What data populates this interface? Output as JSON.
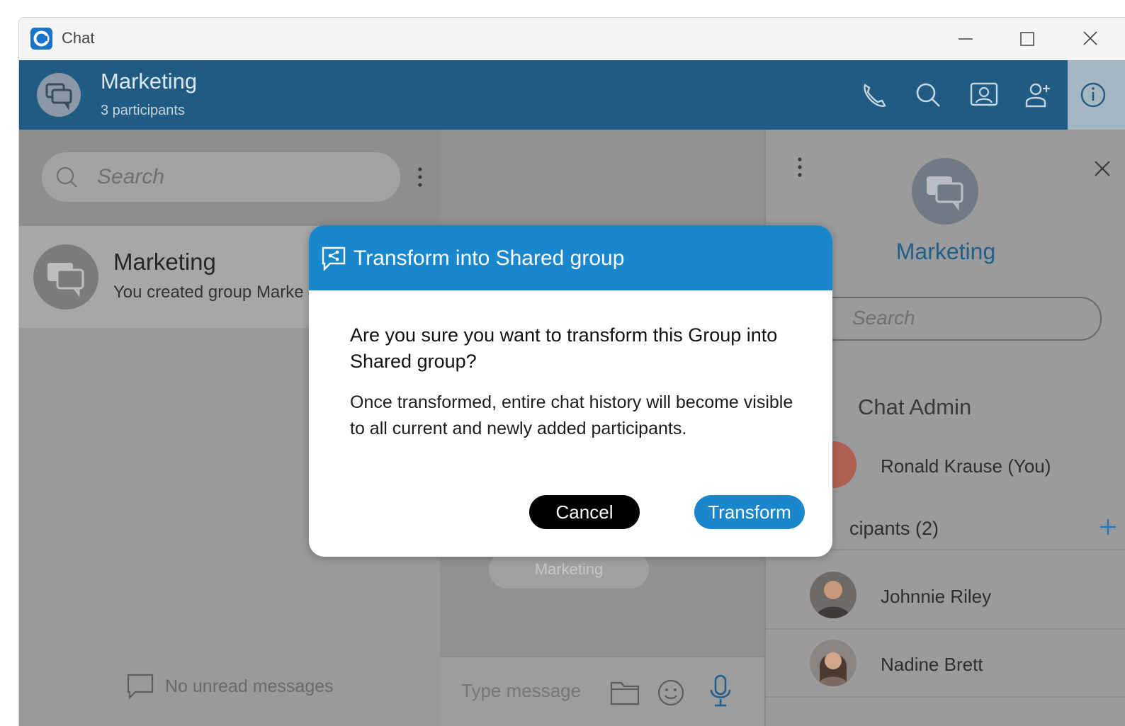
{
  "window": {
    "title": "Chat"
  },
  "header": {
    "title": "Marketing",
    "subtitle": "3 participants"
  },
  "left_pane": {
    "search_placeholder": "Search",
    "conversation": {
      "name": "Marketing",
      "preview": "You created group Marke"
    },
    "empty_state": "No unread messages"
  },
  "middle_pane": {
    "bubble_text": "Marketing",
    "composer_placeholder": "Type message"
  },
  "right_pane": {
    "title": "Marketing",
    "search_placeholder": "Search",
    "admin_section": "Chat Admin",
    "admin_user": "Ronald Krause (You)",
    "participants_section": "cipants (2)",
    "participants": [
      {
        "name": "Johnnie Riley"
      },
      {
        "name": "Nadine Brett"
      }
    ]
  },
  "dialog": {
    "title": "Transform into Shared group",
    "question": "Are you sure you want to transform this Group into Shared group?",
    "message": "Once transformed, entire chat history will become visible to all current and newly added participants.",
    "cancel_label": "Cancel",
    "confirm_label": "Transform"
  },
  "colors": {
    "header_bg": "#1f5b82",
    "dialog_accent": "#1a86cc",
    "cancel_bg": "#000000"
  }
}
